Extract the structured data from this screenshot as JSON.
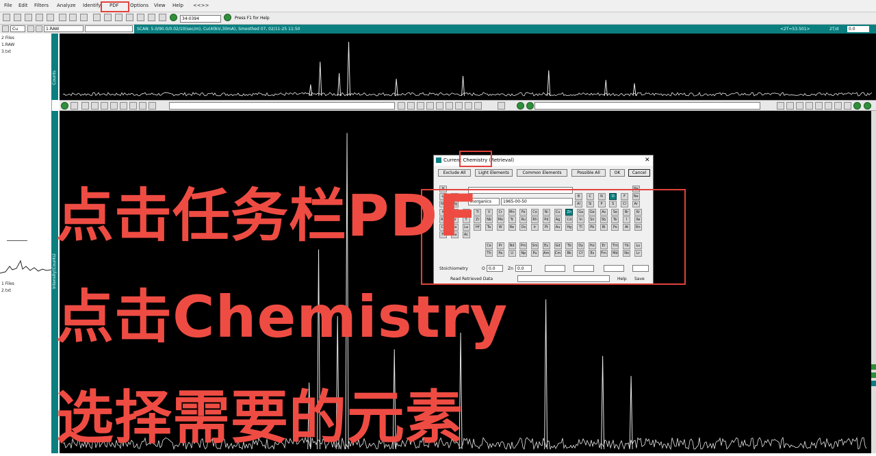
{
  "menu": {
    "items": [
      "File",
      "Edit",
      "Filters",
      "Analyze",
      "Identify",
      "PDF",
      "Options",
      "View",
      "Help",
      "<<>>"
    ]
  },
  "toolbar": {
    "pdf_number": "34-0394",
    "status_hint": "Press F1 for Help",
    "element_select": "Cu",
    "raw_label": "1.RAW",
    "scan_info": "SCAN: 5.0/90.0/0.02/10(sec/m), Cu(40kV,30mA), Smoothed 07, 02/11-25 11:50",
    "right_readout": "<2T=53.501>",
    "right_readout2": "2T/d",
    "right_value": "0.0"
  },
  "left_panel": {
    "top_files": [
      "2 Files",
      "1.RAW",
      "3.txt"
    ],
    "bottom_files": [
      "1 Files",
      "2.txt"
    ],
    "top_strip_label": "Counts",
    "bottom_strip_label": "Intensity(Counts)"
  },
  "dialog": {
    "title": "Current Chemistry (Retrieval)",
    "buttons": [
      "Exclude All",
      "Light Elements",
      "Common Elements",
      "Possible All",
      "OK",
      "Cancel"
    ],
    "subfile_label": "Inorganics",
    "year_range": "1965-00-50",
    "stoichiometry_label": "Stoichiometry",
    "fields": {
      "o_label": "O",
      "o_value": "0.0",
      "zn_label": "Zn",
      "zn_value": "0.0"
    },
    "read_label": "Read Retrieved Data",
    "help_label": "Help",
    "save_label": "Save",
    "periodic_rows": [
      [
        "H",
        "He"
      ],
      [
        "Li",
        "Be",
        "B",
        "C",
        "N",
        "O",
        "F",
        "Ne"
      ],
      [
        "Na",
        "Mg",
        "Al",
        "Si",
        "P",
        "S",
        "Cl",
        "Ar"
      ],
      [
        "K",
        "Ca",
        "Sc",
        "Ti",
        "V",
        "Cr",
        "Mn",
        "Fe",
        "Co",
        "Ni",
        "Cu",
        "Zn",
        "Ga",
        "Ge",
        "As",
        "Se",
        "Br",
        "Kr"
      ],
      [
        "Rb",
        "Sr",
        "Y",
        "Zr",
        "Nb",
        "Mo",
        "Tc",
        "Ru",
        "Rh",
        "Pd",
        "Ag",
        "Cd",
        "In",
        "Sn",
        "Sb",
        "Te",
        "I",
        "Xe"
      ],
      [
        "Cs",
        "Ba",
        "La",
        "Hf",
        "Ta",
        "W",
        "Re",
        "Os",
        "Ir",
        "Pt",
        "Au",
        "Hg",
        "Tl",
        "Pb",
        "Bi",
        "Po",
        "At",
        "Rn"
      ],
      [
        "Fr",
        "Ra",
        "Ac"
      ],
      [
        "Ce",
        "Pr",
        "Nd",
        "Pm",
        "Sm",
        "Eu",
        "Gd",
        "Tb",
        "Dy",
        "Ho",
        "Er",
        "Tm",
        "Yb",
        "Lu"
      ],
      [
        "Th",
        "Pa",
        "U",
        "Np",
        "Pu",
        "Am",
        "Cm",
        "Bk",
        "Cf",
        "Es",
        "Fm",
        "Md",
        "No",
        "Lr"
      ]
    ],
    "selected_elements": [
      "O",
      "Zn"
    ]
  },
  "captions": {
    "line1": "点击任务栏PDF",
    "line2": "点击Chemistry",
    "line3": "选择需要的元素"
  },
  "colors": {
    "accent": "#0b7f80",
    "caption": "#ee4c43",
    "plot_bg": "#000000",
    "trace": "#e8e8e8"
  },
  "chart_data": [
    {
      "type": "line",
      "title": "",
      "xlabel": "",
      "ylabel": "Counts",
      "x": [
        5,
        10,
        15,
        20,
        25,
        28,
        31,
        32,
        33,
        34,
        35,
        36,
        38,
        40,
        45,
        47,
        50,
        55,
        56,
        57,
        60,
        62,
        63,
        65,
        68,
        70,
        75,
        80,
        85,
        90
      ],
      "values": [
        5,
        6,
        6,
        7,
        8,
        12,
        20,
        60,
        8,
        40,
        95,
        10,
        9,
        30,
        8,
        35,
        8,
        9,
        45,
        8,
        10,
        28,
        8,
        22,
        8,
        9,
        10,
        8,
        9,
        8
      ]
    },
    {
      "type": "line",
      "title": "",
      "xlabel": "",
      "ylabel": "Intensity(Counts)",
      "x": [
        5,
        10,
        15,
        20,
        25,
        28,
        31,
        32,
        33,
        34,
        35,
        36,
        38,
        40,
        45,
        47,
        50,
        55,
        56,
        57,
        60,
        62,
        63,
        65,
        68,
        70,
        75,
        80,
        85,
        90
      ],
      "values": [
        5,
        6,
        6,
        7,
        8,
        12,
        20,
        60,
        8,
        40,
        95,
        10,
        9,
        30,
        8,
        35,
        8,
        9,
        45,
        8,
        10,
        28,
        8,
        22,
        8,
        9,
        10,
        8,
        9,
        8
      ]
    }
  ]
}
